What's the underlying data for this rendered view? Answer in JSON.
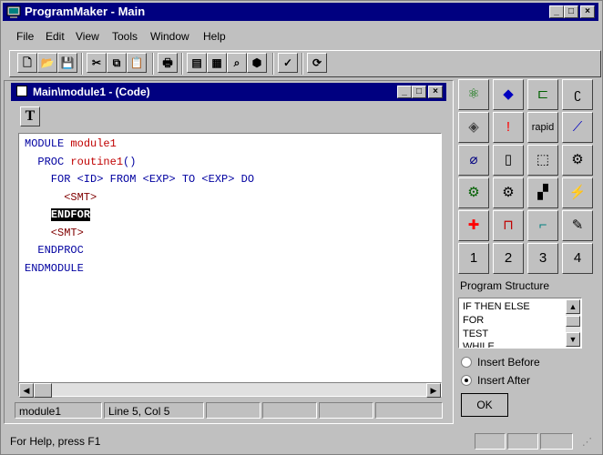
{
  "app": {
    "title": "ProgramMaker - Main"
  },
  "menu": [
    "File",
    "Edit",
    "View",
    "Tools",
    "Window",
    "Help"
  ],
  "toolbar": [
    {
      "name": "new-icon",
      "glyph": "🗋"
    },
    {
      "name": "open-icon",
      "glyph": "📂"
    },
    {
      "name": "save-icon",
      "glyph": "💾"
    },
    {
      "name": "cut-icon",
      "glyph": "✂"
    },
    {
      "name": "copy-icon",
      "glyph": "⧉"
    },
    {
      "name": "paste-icon",
      "glyph": "📋"
    },
    {
      "name": "print-icon",
      "glyph": "🖶"
    },
    {
      "name": "window-icon",
      "glyph": "▤"
    },
    {
      "name": "table-icon",
      "glyph": "▦"
    },
    {
      "name": "find-icon",
      "glyph": "⌕"
    },
    {
      "name": "module-icon",
      "glyph": "⬢"
    },
    {
      "name": "check-icon",
      "glyph": "✓"
    },
    {
      "name": "refresh-icon",
      "glyph": "⟳"
    }
  ],
  "child": {
    "title": "Main\\module1 - (Code)",
    "t_button": "T"
  },
  "code": [
    [
      {
        "t": "MODULE ",
        "c": "kw"
      },
      {
        "t": "module1",
        "c": "id"
      }
    ],
    [
      {
        "t": "  PROC ",
        "c": "kw"
      },
      {
        "t": "routine1",
        "c": "id"
      },
      {
        "t": "()",
        "c": "kw"
      }
    ],
    [
      {
        "t": "    FOR <ID> FROM <EXP> TO <EXP> DO",
        "c": "kw"
      }
    ],
    [
      {
        "t": "      <SMT>",
        "c": "ph"
      }
    ],
    [
      {
        "t": "    ",
        "c": "kw"
      },
      {
        "t": "ENDFOR",
        "c": "hl"
      }
    ],
    [
      {
        "t": "    <SMT>",
        "c": "ph"
      }
    ],
    [
      {
        "t": "  ENDPROC",
        "c": "kw"
      }
    ],
    [
      {
        "t": "ENDMODULE",
        "c": "kw"
      }
    ]
  ],
  "status_child": {
    "module": "module1",
    "line": "Line   5, Col   5"
  },
  "palette": [
    {
      "name": "graph-icon",
      "glyph": "⚛",
      "color": "#007000"
    },
    {
      "name": "shapes-icon",
      "glyph": "◆",
      "color": "#0000c0"
    },
    {
      "name": "align-icon",
      "glyph": "⊏",
      "color": "#006000"
    },
    {
      "name": "gripper-icon",
      "glyph": "ʗ",
      "color": "#000000"
    },
    {
      "name": "cube-icon",
      "glyph": "◈",
      "color": "#404040"
    },
    {
      "name": "exclamation-icon",
      "glyph": "!",
      "color": "#ff0000"
    },
    {
      "name": "rapid-icon",
      "glyph": "rapid",
      "color": "#000000"
    },
    {
      "name": "chart-icon",
      "glyph": "⟋",
      "color": "#0000c0"
    },
    {
      "name": "no-icon",
      "glyph": "⌀",
      "color": "#000080"
    },
    {
      "name": "panel-icon",
      "glyph": "▯",
      "color": "#000000"
    },
    {
      "name": "select-icon",
      "glyph": "⬚",
      "color": "#000000"
    },
    {
      "name": "robot-icon",
      "glyph": "⚙",
      "color": "#000000"
    },
    {
      "name": "gear-plus-icon",
      "glyph": "⚙",
      "color": "#006000"
    },
    {
      "name": "gears-icon",
      "glyph": "⚙",
      "color": "#000000"
    },
    {
      "name": "checker-icon",
      "glyph": "▞",
      "color": "#000000"
    },
    {
      "name": "bolt-icon",
      "glyph": "⚡",
      "color": "#008000"
    },
    {
      "name": "delete-icon",
      "glyph": "✚",
      "color": "#ff0000"
    },
    {
      "name": "tool-icon",
      "glyph": "⊓",
      "color": "#c00000"
    },
    {
      "name": "drill-icon",
      "glyph": "⌐",
      "color": "#008080"
    },
    {
      "name": "pencil-icon",
      "glyph": "✎",
      "color": "#000000"
    },
    {
      "name": "one-icon",
      "glyph": "1",
      "color": "#000000"
    },
    {
      "name": "two-icon",
      "glyph": "2",
      "color": "#000000"
    },
    {
      "name": "three-icon",
      "glyph": "3",
      "color": "#000000"
    },
    {
      "name": "four-icon",
      "glyph": "4",
      "color": "#000000"
    }
  ],
  "program_structure": {
    "label": "Program Structure",
    "items": [
      "IF THEN ELSE",
      "FOR",
      "TEST",
      "WHILE"
    ]
  },
  "insert": {
    "before": "Insert Before",
    "after": "Insert After"
  },
  "ok": "OK",
  "status": "For Help, press F1",
  "colors": {
    "title": "#000080",
    "face": "#c0c0c0"
  }
}
